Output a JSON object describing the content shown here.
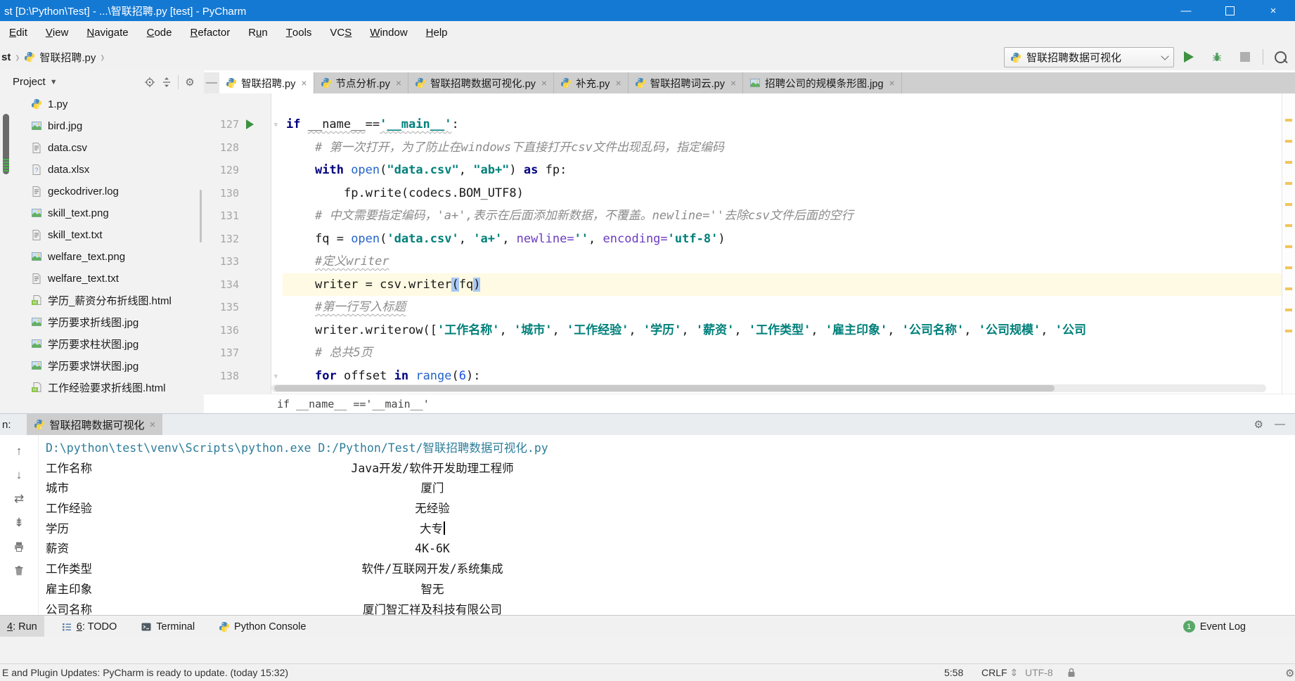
{
  "colors": {
    "titlebar": "#1479D3",
    "keyword": "#000080",
    "string": "#00807A",
    "function": "#2464C8",
    "comment": "#8C8C8C",
    "number": "#1750EB",
    "param": "#6A3BBF",
    "current_line": "#FFFAE3",
    "brace_match": "#A9C8F2",
    "console_cmd": "#2D7D9A",
    "run_green": "#59A869",
    "stripe_yellow": "#F2C55C"
  },
  "window": {
    "title": "st [D:\\Python\\Test] - ...\\智联招聘.py [test] - PyCharm",
    "minimize": "—",
    "close": "×"
  },
  "menu": {
    "items": [
      {
        "label": "Edit",
        "u": 0
      },
      {
        "label": "View",
        "u": 0
      },
      {
        "label": "Navigate",
        "u": 0
      },
      {
        "label": "Code",
        "u": 0
      },
      {
        "label": "Refactor",
        "u": 0
      },
      {
        "label": "Run",
        "u": 1
      },
      {
        "label": "Tools",
        "u": 0
      },
      {
        "label": "VCS",
        "u": 2
      },
      {
        "label": "Window",
        "u": 0
      },
      {
        "label": "Help",
        "u": 0
      }
    ]
  },
  "toolbar": {
    "breadcrumb_root": "st",
    "breadcrumb_file": "智联招聘.py",
    "run_config": "智联招聘数据可视化"
  },
  "project": {
    "title": "Project",
    "files": [
      {
        "name": "1.py",
        "icon": "py"
      },
      {
        "name": "bird.jpg",
        "icon": "img"
      },
      {
        "name": "data.csv",
        "icon": "txt"
      },
      {
        "name": "data.xlsx",
        "icon": "unknown"
      },
      {
        "name": "geckodriver.log",
        "icon": "txt"
      },
      {
        "name": "skill_text.png",
        "icon": "img"
      },
      {
        "name": "skill_text.txt",
        "icon": "txt"
      },
      {
        "name": "welfare_text.png",
        "icon": "img"
      },
      {
        "name": "welfare_text.txt",
        "icon": "txt"
      },
      {
        "name": "学历_薪资分布折线图.html",
        "icon": "html"
      },
      {
        "name": "学历要求折线图.jpg",
        "icon": "img"
      },
      {
        "name": "学历要求柱状图.jpg",
        "icon": "img"
      },
      {
        "name": "学历要求饼状图.jpg",
        "icon": "img"
      },
      {
        "name": "工作经验要求折线图.html",
        "icon": "html"
      }
    ]
  },
  "editor": {
    "tabs": [
      {
        "name": "智联招聘.py",
        "icon": "py",
        "active": true
      },
      {
        "name": "节点分析.py",
        "icon": "py",
        "active": false
      },
      {
        "name": "智联招聘数据可视化.py",
        "icon": "py",
        "active": false
      },
      {
        "name": "补充.py",
        "icon": "py",
        "active": false
      },
      {
        "name": "智联招聘词云.py",
        "icon": "py",
        "active": false
      },
      {
        "name": "招聘公司的规模条形图.jpg",
        "icon": "img",
        "active": false
      }
    ],
    "lines": [
      {
        "n": 127,
        "ind": 0,
        "run": true,
        "fold": true,
        "toks": [
          [
            "if ",
            "kw"
          ],
          [
            "__name__",
            "wavy"
          ],
          [
            "==",
            ""
          ],
          [
            "'__main__'",
            "str wavy"
          ],
          [
            ":",
            ""
          ]
        ]
      },
      {
        "n": 128,
        "ind": 1,
        "toks": [
          [
            "# 第一次打开，为了防止在windows下直接打开csv文件出现乱码，指定编码",
            "cm"
          ]
        ]
      },
      {
        "n": 129,
        "ind": 1,
        "toks": [
          [
            "with ",
            "kw"
          ],
          [
            "open",
            "fn"
          ],
          [
            "(",
            ""
          ],
          [
            "\"data.csv\"",
            "str"
          ],
          [
            ", ",
            ""
          ],
          [
            "\"ab+\"",
            "str"
          ],
          [
            ") ",
            ""
          ],
          [
            "as ",
            "kw"
          ],
          [
            "fp:",
            ""
          ]
        ]
      },
      {
        "n": 130,
        "ind": 2,
        "toks": [
          [
            "fp.write(codecs.BOM_UTF8)",
            ""
          ]
        ]
      },
      {
        "n": 131,
        "ind": 1,
        "toks": [
          [
            "# 中文需要指定编码，'a+',表示在后面添加新数据，不覆盖。newline=''去除csv文件后面的空行",
            "cm"
          ]
        ]
      },
      {
        "n": 132,
        "ind": 1,
        "toks": [
          [
            "fq = ",
            ""
          ],
          [
            "open",
            "fn"
          ],
          [
            "(",
            ""
          ],
          [
            "'data.csv'",
            "str"
          ],
          [
            ", ",
            ""
          ],
          [
            "'a+'",
            "str"
          ],
          [
            ", ",
            ""
          ],
          [
            "newline=",
            "param"
          ],
          [
            "''",
            "str"
          ],
          [
            ", ",
            ""
          ],
          [
            "encoding=",
            "param"
          ],
          [
            "'utf-8'",
            "str"
          ],
          [
            ")",
            ""
          ]
        ]
      },
      {
        "n": 133,
        "ind": 1,
        "toks": [
          [
            "#定义writer",
            "cm wavy"
          ]
        ]
      },
      {
        "n": 134,
        "ind": 1,
        "hl": true,
        "toks": [
          [
            "writer = csv.writer",
            ""
          ],
          [
            "(",
            "brhl"
          ],
          [
            "fq",
            ""
          ],
          [
            ")",
            "brhl"
          ]
        ]
      },
      {
        "n": 135,
        "ind": 1,
        "toks": [
          [
            "#第一行写入标题",
            "cm wavy"
          ]
        ]
      },
      {
        "n": 136,
        "ind": 1,
        "toks": [
          [
            "writer.writerow([",
            ""
          ],
          [
            "'工作名称'",
            "str"
          ],
          [
            ", ",
            ""
          ],
          [
            "'城市'",
            "str"
          ],
          [
            ", ",
            ""
          ],
          [
            "'工作经验'",
            "str"
          ],
          [
            ", ",
            ""
          ],
          [
            "'学历'",
            "str"
          ],
          [
            ", ",
            ""
          ],
          [
            "'薪资'",
            "str"
          ],
          [
            ", ",
            ""
          ],
          [
            "'工作类型'",
            "str"
          ],
          [
            ", ",
            ""
          ],
          [
            "'雇主印象'",
            "str"
          ],
          [
            ", ",
            ""
          ],
          [
            "'公司名称'",
            "str"
          ],
          [
            ", ",
            ""
          ],
          [
            "'公司规模'",
            "str"
          ],
          [
            ", ",
            ""
          ],
          [
            "'公司",
            "str"
          ]
        ]
      },
      {
        "n": 137,
        "ind": 1,
        "toks": [
          [
            "# 总共5页",
            "cm"
          ]
        ]
      },
      {
        "n": 138,
        "ind": 1,
        "fold": true,
        "toks": [
          [
            "for ",
            "kw"
          ],
          [
            "offset ",
            ""
          ],
          [
            "in ",
            "kw"
          ],
          [
            "range",
            "fn"
          ],
          [
            "(",
            ""
          ],
          [
            "6",
            "num"
          ],
          [
            "):",
            ""
          ]
        ]
      }
    ],
    "context_line": "if __name__ =='__main__'"
  },
  "run_panel": {
    "prefix": "n:",
    "tab": "智联招聘数据可视化",
    "console_cmd": "D:\\python\\test\\venv\\Scripts\\python.exe D:/Python/Test/智联招聘数据可视化.py",
    "rows": [
      {
        "label": "工作名称",
        "value": "Java开发/软件开发助理工程师"
      },
      {
        "label": "城市",
        "value": "厦门"
      },
      {
        "label": "工作经验",
        "value": "无经验"
      },
      {
        "label": "学历",
        "value": "大专",
        "cursor": true
      },
      {
        "label": "薪资",
        "value": "4K-6K"
      },
      {
        "label": "工作类型",
        "value": "软件/互联网开发/系统集成"
      },
      {
        "label": "雇主印象",
        "value": "智无"
      },
      {
        "label": "公司名称",
        "value": "厦门智汇祥及科技有限公司"
      }
    ]
  },
  "bottom_bar": {
    "items": [
      {
        "label": "4: Run",
        "u": 0,
        "icon": "",
        "active": true
      },
      {
        "label": "6: TODO",
        "u": 0,
        "icon": "todo",
        "active": false
      },
      {
        "label": "Terminal",
        "icon": "terminal",
        "active": false
      },
      {
        "label": "Python Console",
        "icon": "py",
        "active": false
      }
    ],
    "event_log": {
      "badge": "1",
      "label": "Event Log"
    }
  },
  "status_bar": {
    "message": "E and Plugin Updates: PyCharm is ready to update. (today 15:32)",
    "caret": "5:58",
    "line_ending": "CRLF",
    "encoding": "UTF-8"
  }
}
